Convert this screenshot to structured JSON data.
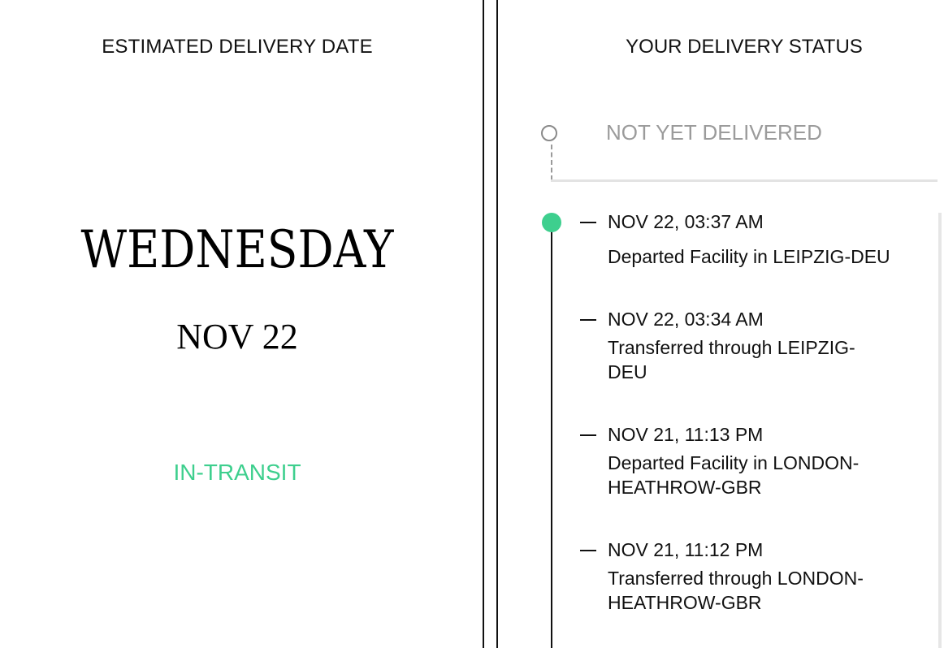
{
  "estimate": {
    "heading": "ESTIMATED DELIVERY DATE",
    "weekday": "WEDNESDAY",
    "date": "NOV 22",
    "status": "IN-TRANSIT",
    "status_color": "#3ecf8e"
  },
  "tracking": {
    "heading": "YOUR DELIVERY STATUS",
    "pending_label": "NOT YET DELIVERED",
    "events": [
      {
        "time": "NOV 22, 03:37 AM",
        "description": "Departed Facility in LEIPZIG-DEU"
      },
      {
        "time": "NOV 22, 03:34 AM",
        "description": "Transferred through LEIPZIG-DEU"
      },
      {
        "time": "NOV 21, 11:13 PM",
        "description": "Departed Facility in LONDON-HEATHROW-GBR"
      },
      {
        "time": "NOV 21, 11:12 PM",
        "description": "Transferred through LONDON-HEATHROW-GBR"
      }
    ]
  },
  "icons": {
    "pending": "empty-circle-icon",
    "current": "green-dot-icon"
  }
}
